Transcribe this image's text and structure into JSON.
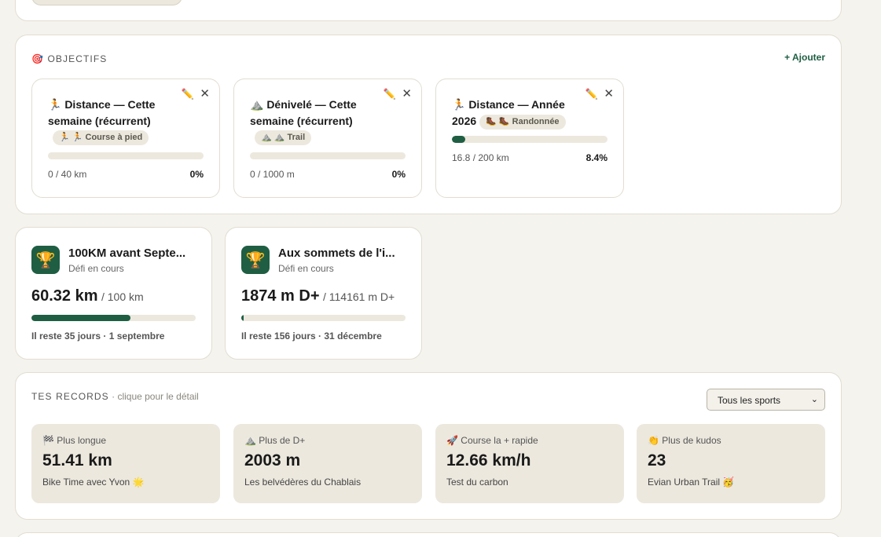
{
  "objectives": {
    "icon": "🎯",
    "title": "OBJECTIFS",
    "add_label": "+ Ajouter",
    "edit_icon": "✏️",
    "close_icon": "✕",
    "goals": [
      {
        "title": "🏃 Distance — Cette semaine (récurrent)",
        "tag": "🏃 🏃 Course à pied",
        "progress_text": "0 / 40 km",
        "percent_text": "0%",
        "progress": 0
      },
      {
        "title": "⛰️ Dénivelé — Cette semaine (récurrent)",
        "tag": "⛰️ ⛰️ Trail",
        "progress_text": "0 / 1000 m",
        "percent_text": "0%",
        "progress": 0
      },
      {
        "title": "🏃 Distance — Année 2026",
        "tag": "🥾 🥾 Randonnée",
        "progress_text": "16.8 / 200 km",
        "percent_text": "8.4%",
        "progress": 0.084
      }
    ]
  },
  "challenges": [
    {
      "icon": "🏆",
      "title": "100KM avant Septe...",
      "status": "Défi en cours",
      "value": "60.32 km",
      "target": "/ 100 km",
      "progress": 0.6032,
      "footer": "Il reste 35 jours · 1 septembre"
    },
    {
      "icon": "🏆",
      "title": "Aux sommets de l'i...",
      "status": "Défi en cours",
      "value": "1874 m D+",
      "target": "/ 114161 m D+",
      "progress": 0.0164,
      "footer": "Il reste 156 jours · 31 décembre"
    }
  ],
  "records": {
    "title": "TES RECORDS",
    "subtitle": " · clique pour le détail",
    "filter": {
      "selected": "Tous les sports",
      "caret": "⌄"
    },
    "items": [
      {
        "label": "🏁 Plus longue",
        "value": "51.41 km",
        "sub": "Bike Time avec Yvon 🌟"
      },
      {
        "label": "⛰️ Plus de D+",
        "value": "2003 m",
        "sub": "Les belvédères du Chablais"
      },
      {
        "label": "🚀 Course la + rapide",
        "value": "12.66 km/h",
        "sub": "Test du carbon"
      },
      {
        "label": "👏 Plus de kudos",
        "value": "23",
        "sub": "Evian Urban Trail 🥳"
      }
    ]
  },
  "colors": {
    "accent": "#1f5e43",
    "background": "#f5f3ed",
    "tile": "#ece8de"
  }
}
